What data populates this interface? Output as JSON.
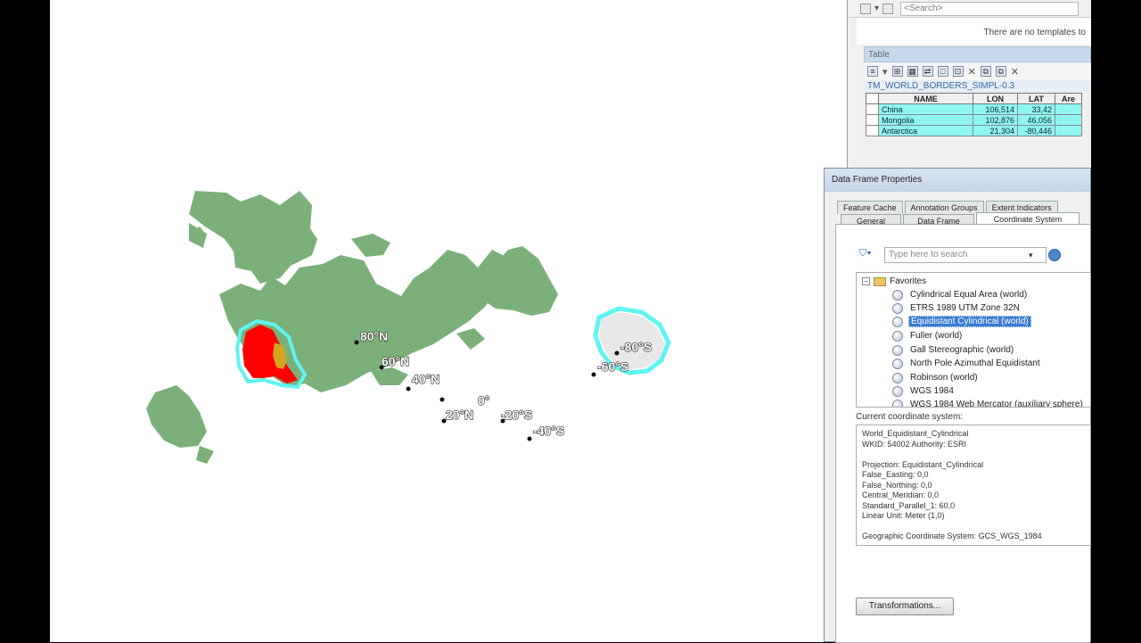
{
  "map": {
    "latitude_labels": [
      "80°N",
      "60°N",
      "40°N",
      "20°N",
      "0°",
      "-20°S",
      "-40°S",
      "-60°S",
      "-80°S"
    ],
    "colors": {
      "land": "#7cb07a",
      "highlight_red": "#ff0000",
      "highlight_orange": "#d4a520",
      "selection_outline": "#5ff5f0",
      "antarctica_fill": "#e8e8e8"
    }
  },
  "table_window": {
    "search_placeholder": "<Search>",
    "no_templates": "There are no templates to",
    "title": "Table",
    "layer_name": "TM_WORLD_BORDERS_SIMPL-0.3",
    "columns": [
      "NAME",
      "LON",
      "LAT",
      "Are"
    ],
    "rows": [
      {
        "name": "China",
        "lon": "106,514",
        "lat": "33,42"
      },
      {
        "name": "Mongolia",
        "lon": "102,876",
        "lat": "46,056"
      },
      {
        "name": "Antarctica",
        "lon": "21,304",
        "lat": "-80,446"
      }
    ]
  },
  "dialog": {
    "title": "Data Frame Properties",
    "tabs_row1": [
      "Feature Cache",
      "Annotation Groups",
      "Extent Indicators"
    ],
    "tabs_row2": [
      "General",
      "Data Frame",
      "Coordinate System"
    ],
    "search_placeholder": "Type here to search",
    "folder": "Favorites",
    "items": [
      "Cylindrical Equal Area (world)",
      "ETRS 1989 UTM Zone 32N",
      "Equidistant Cylindrical (world)",
      "Fuller (world)",
      "Gall Stereographic (world)",
      "North Pole Azimuthal Equidistant",
      "Robinson (world)",
      "WGS 1984",
      "WGS 1984 Web Mercator (auxiliary sphere)"
    ],
    "current_label": "Current coordinate system:",
    "current_text": "World_Equidistant_Cylindrical\nWKID: 54002 Authority: ESRI\n\nProjection: Equidistant_Cylindrical\nFalse_Easting: 0,0\nFalse_Northing: 0,0\nCentral_Meridian: 0,0\nStandard_Parallel_1: 60,0\nLinear Unit: Meter (1,0)\n\nGeographic Coordinate System: GCS_WGS_1984",
    "transform_button": "Transformations..."
  }
}
